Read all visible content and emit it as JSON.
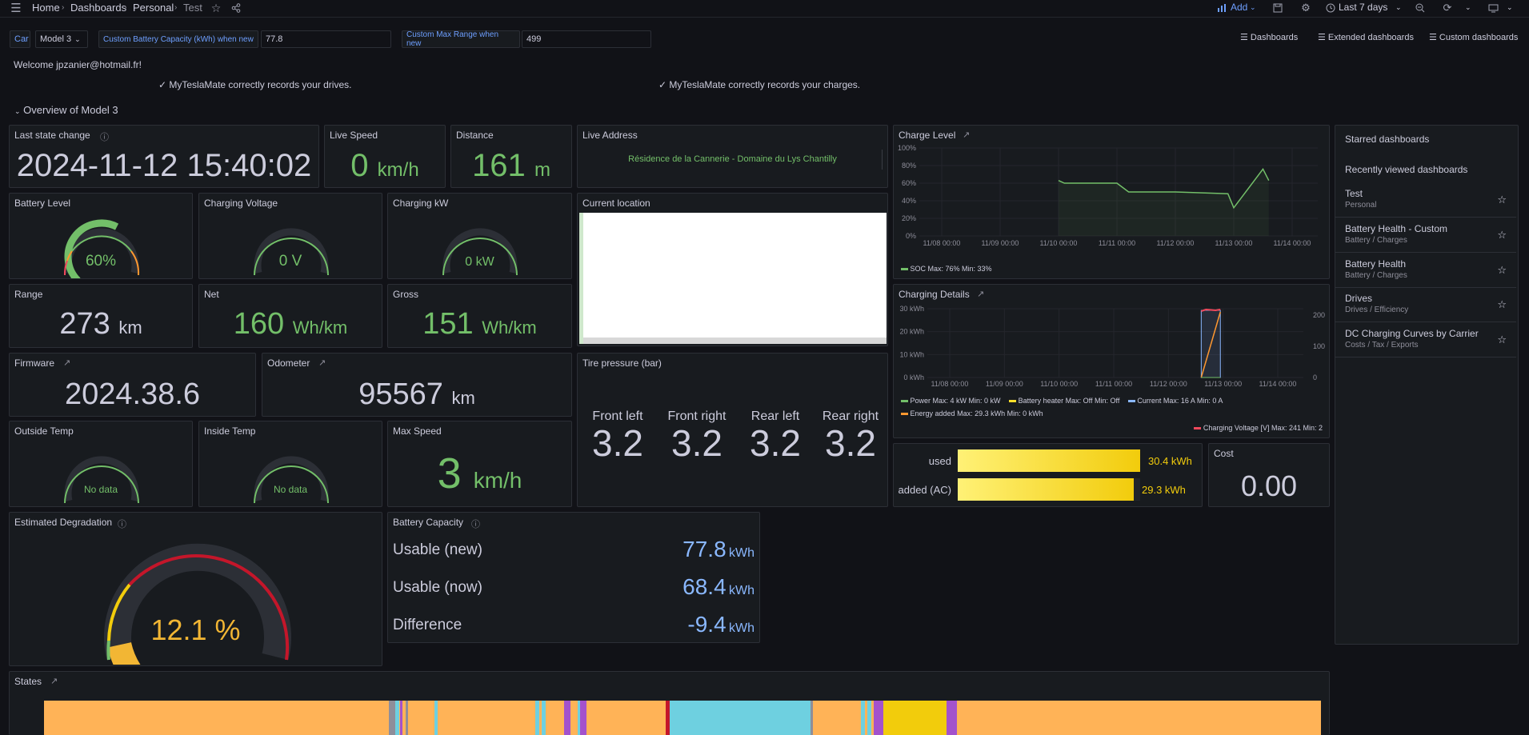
{
  "nav": {
    "breadcrumb": [
      "Home",
      "Dashboards",
      "Personal",
      "Test"
    ],
    "add_label": "Add",
    "time_range": "Last 7 days"
  },
  "vars": {
    "car_label": "Car",
    "car_value": "Model 3",
    "capacity_label": "Custom Battery Capacity (kWh) when new",
    "capacity_value": "77.8",
    "range_label": "Custom Max Range when new",
    "range_value": "499"
  },
  "links": [
    "Dashboards",
    "Extended dashboards",
    "Custom dashboards"
  ],
  "welcome": "Welcome jpzanier@hotmail.fr!",
  "drives_msg": "✓ MyTeslaMate correctly records your drives.",
  "charges_msg": "✓ MyTeslaMate correctly records your charges.",
  "row_title": "Overview of Model 3",
  "panels": {
    "last_state_change": {
      "title": "Last state change",
      "value": "2024-11-12 15:40:02"
    },
    "live_speed": {
      "title": "Live Speed",
      "value": "0",
      "unit": "km/h"
    },
    "distance": {
      "title": "Distance",
      "value": "161",
      "unit": "m"
    },
    "live_address": {
      "title": "Live Address",
      "value": "Résidence de la Cannerie - Domaine du Lys Chantilly"
    },
    "battery_level": {
      "title": "Battery Level",
      "value": "60%",
      "level": 60
    },
    "charging_voltage": {
      "title": "Charging Voltage",
      "value": "0 V"
    },
    "charging_kw": {
      "title": "Charging kW",
      "value": "0 kW"
    },
    "current_location": {
      "title": "Current location"
    },
    "range": {
      "title": "Range",
      "value": "273",
      "unit": "km"
    },
    "net": {
      "title": "Net",
      "value": "160",
      "unit": "Wh/km"
    },
    "gross": {
      "title": "Gross",
      "value": "151",
      "unit": "Wh/km"
    },
    "firmware": {
      "title": "Firmware",
      "value": "2024.38.6"
    },
    "odometer": {
      "title": "Odometer",
      "value": "95567",
      "unit": "km"
    },
    "tire_pressure": {
      "title": "Tire pressure (bar)",
      "tires": [
        {
          "label": "Front left",
          "value": "3.2"
        },
        {
          "label": "Front right",
          "value": "3.2"
        },
        {
          "label": "Rear left",
          "value": "3.2"
        },
        {
          "label": "Rear right",
          "value": "3.2"
        }
      ]
    },
    "outside_temp": {
      "title": "Outside Temp",
      "value": "No data"
    },
    "inside_temp": {
      "title": "Inside Temp",
      "value": "No data"
    },
    "max_speed": {
      "title": "Max Speed",
      "value": "3",
      "unit": "km/h"
    },
    "energy": {
      "used_label": "used",
      "used_value": "30.4 kWh",
      "used_fraction": 1.0,
      "added_label": "added (AC)",
      "added_value": "29.3 kWh",
      "added_fraction": 0.964
    },
    "cost": {
      "title": "Cost",
      "value": "0.00"
    },
    "degradation": {
      "title": "Estimated Degradation",
      "value": "12.1 %",
      "level": 12.1
    },
    "battery_capacity": {
      "title": "Battery Capacity",
      "rows": [
        {
          "label": "Usable (new)",
          "value": "77.8",
          "unit": "kWh"
        },
        {
          "label": "Usable (now)",
          "value": "68.4",
          "unit": "kWh"
        },
        {
          "label": "Difference",
          "value": "-9.4",
          "unit": "kWh"
        }
      ]
    },
    "states": {
      "title": "States"
    },
    "charge_level": {
      "title": "Charge Level"
    },
    "charging_details": {
      "title": "Charging Details"
    }
  },
  "chart_data": [
    {
      "type": "line",
      "title": "Charge Level",
      "x_ticks": [
        "11/08 00:00",
        "11/09 00:00",
        "11/10 00:00",
        "11/11 00:00",
        "11/12 00:00",
        "11/13 00:00",
        "11/14 00:00"
      ],
      "y_ticks": [
        "0%",
        "20%",
        "40%",
        "60%",
        "80%",
        "100%"
      ],
      "ylim": [
        0,
        100
      ],
      "series": [
        {
          "name": "SOC",
          "color": "#73bf69",
          "points": [
            [
              2.0,
              63
            ],
            [
              2.1,
              60
            ],
            [
              3.0,
              60
            ],
            [
              3.1,
              55
            ],
            [
              3.2,
              50
            ],
            [
              4.0,
              50
            ],
            [
              4.9,
              48
            ],
            [
              5.0,
              32
            ],
            [
              5.5,
              76
            ],
            [
              5.6,
              63
            ]
          ]
        }
      ],
      "legend": "SOC  Max: 76%  Min: 33%"
    },
    {
      "type": "line",
      "title": "Charging Details",
      "x_ticks": [
        "11/08 00:00",
        "11/09 00:00",
        "11/10 00:00",
        "11/11 00:00",
        "11/12 00:00",
        "11/13 00:00",
        "11/14 00:00"
      ],
      "y_ticks": [
        "0 kWh",
        "10 kWh",
        "20 kWh",
        "30 kWh"
      ],
      "y2_ticks": [
        "0",
        "100",
        "200"
      ],
      "ylim": [
        0,
        30
      ],
      "series": [
        {
          "name": "Power",
          "color": "#73bf69",
          "legend": "Max: 4 kW  Min: 0 kW"
        },
        {
          "name": "Battery heater",
          "color": "#fade2a",
          "legend": "Max: Off  Min: Off"
        },
        {
          "name": "Current",
          "color": "#8ab8ff",
          "legend": "Max: 16 A  Min: 0 A"
        },
        {
          "name": "Energy added",
          "color": "#ff9830",
          "legend": "Max: 29.3 kWh  Min: 0 kWh"
        },
        {
          "name": "Charging Voltage [V]",
          "color": "#f2495c",
          "legend": "Max: 241  Min: 2"
        }
      ]
    }
  ],
  "sidebar": {
    "starred_title": "Starred dashboards",
    "recent_title": "Recently viewed dashboards",
    "items": [
      {
        "title": "Test",
        "sub": "Personal"
      },
      {
        "title": "Battery Health - Custom",
        "sub": "Battery / Charges"
      },
      {
        "title": "Battery Health",
        "sub": "Battery / Charges"
      },
      {
        "title": "Drives",
        "sub": "Drives / Efficiency"
      },
      {
        "title": "DC Charging Curves by Carrier",
        "sub": "Costs / Tax / Exports"
      }
    ]
  },
  "colors": {
    "green": "#73bf69",
    "yellow": "#f2cc0c",
    "red": "#c4162a",
    "orange": "#ffb357",
    "blue": "#6ed0e0",
    "purple": "#a352cc"
  }
}
